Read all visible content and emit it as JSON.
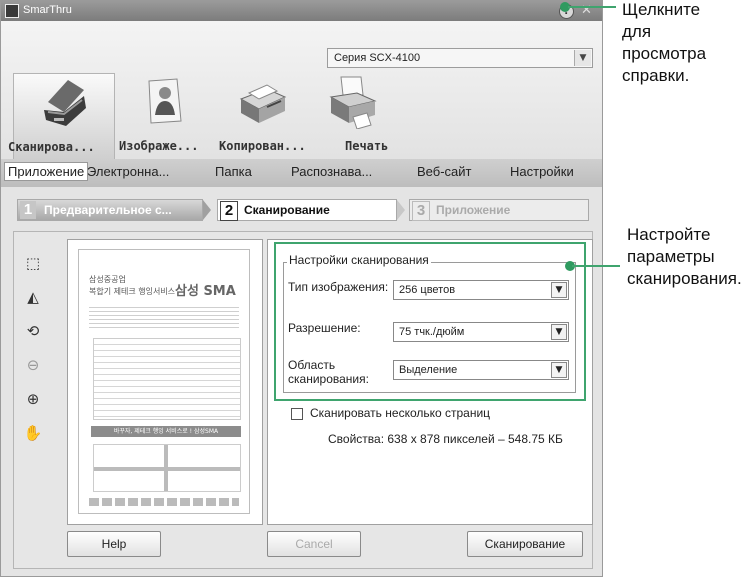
{
  "window": {
    "title": "SmarThru",
    "help_glyph": "?",
    "close_glyph": "✕"
  },
  "printer_series": {
    "selected": "Серия SCX-4100"
  },
  "modules": [
    {
      "label": "Сканирова...",
      "icon": "scanner-icon",
      "active": true
    },
    {
      "label": "Изображе...",
      "icon": "image-icon"
    },
    {
      "label": "Копирован...",
      "icon": "copier-icon"
    },
    {
      "label": "Печать",
      "icon": "printer-icon"
    }
  ],
  "app_tabs": [
    {
      "label": "Приложение"
    },
    {
      "label": "Электронна..."
    },
    {
      "label": "Папка"
    },
    {
      "label": "Распознава..."
    },
    {
      "label": "Веб-сайт"
    },
    {
      "label": "Настройки"
    }
  ],
  "steps": [
    {
      "num": "1",
      "label": "Предварительное с...",
      "state": "done"
    },
    {
      "num": "2",
      "label": "Сканирование",
      "state": "active"
    },
    {
      "num": "3",
      "label": "Приложение",
      "state": "disabled"
    }
  ],
  "tools": [
    "select-area-icon",
    "flip-icon",
    "rotate-icon",
    "zoom-out-icon",
    "zoom-in-icon",
    "pan-hand-icon"
  ],
  "preview_document": {
    "line1": "삼성중공업",
    "line2": "복합기 제테크 행잉서비스",
    "brand": "삼성 SMA",
    "banner": "바꾸자, 제테크 행잉 서비스로 ! 삼성SMA"
  },
  "scan_settings": {
    "legend": "Настройки сканирования",
    "image_type": {
      "label": "Тип изображения:",
      "value": "256 цветов"
    },
    "resolution": {
      "label": "Разрешение:",
      "value": "75 тчк./дюйм"
    },
    "scan_area": {
      "label_line1": "Область",
      "label_line2": "сканирования:",
      "value": "Выделение"
    }
  },
  "multi_page": {
    "label": "Сканировать несколько страниц",
    "checked": false
  },
  "properties": "Свойства: 638 x 878 пикселей – 548.75 КБ",
  "buttons": {
    "help": "Help",
    "cancel": "Cancel",
    "scan": "Сканирование"
  },
  "annotations": {
    "help_note": [
      "Щелкните",
      "для",
      "просмотра",
      "справки."
    ],
    "settings_note": [
      "Настройте",
      "параметры",
      "сканирования."
    ]
  },
  "colors": {
    "annotation_green": "#3fa46e"
  }
}
